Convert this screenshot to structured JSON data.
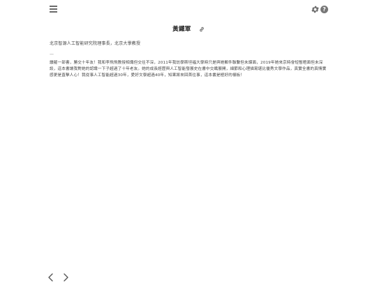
{
  "toolbar": {
    "menu_icon": "hamburger-menu-icon",
    "settings_icon": "gear-icon",
    "help_label": "?"
  },
  "article": {
    "title": "黃鐵軍",
    "link_icon": "link-icon",
    "subtitle": "北京智源人工智能研究院理事長，北京大學教授",
    "divider": "—",
    "body": "讀罷一部書，勝交十年友！我和李飛飛教授相識但交往不深，2011年我訪學斯坦福大學時只是與她郵件聯繫但未謀面，2019年她來京時會短暫晤面但未深談，這本書讓我對她的認識一下子超過了十年老友。她的成長經歷與人工智能發展史在書中交織展開，細節和心理描寫堪比優秀文學作品，真實全書的真情實感更是直擊人心！我從事人工智能超過30年，愛好文學超過40年，知果將來回首往事，這本書是極好的樣板！"
  },
  "pager": {
    "prev_icon": "chevron-left-icon",
    "next_icon": "chevron-right-icon"
  },
  "colors": {
    "icon": "#6b6b6b",
    "text": "#444444",
    "title": "#222222"
  }
}
